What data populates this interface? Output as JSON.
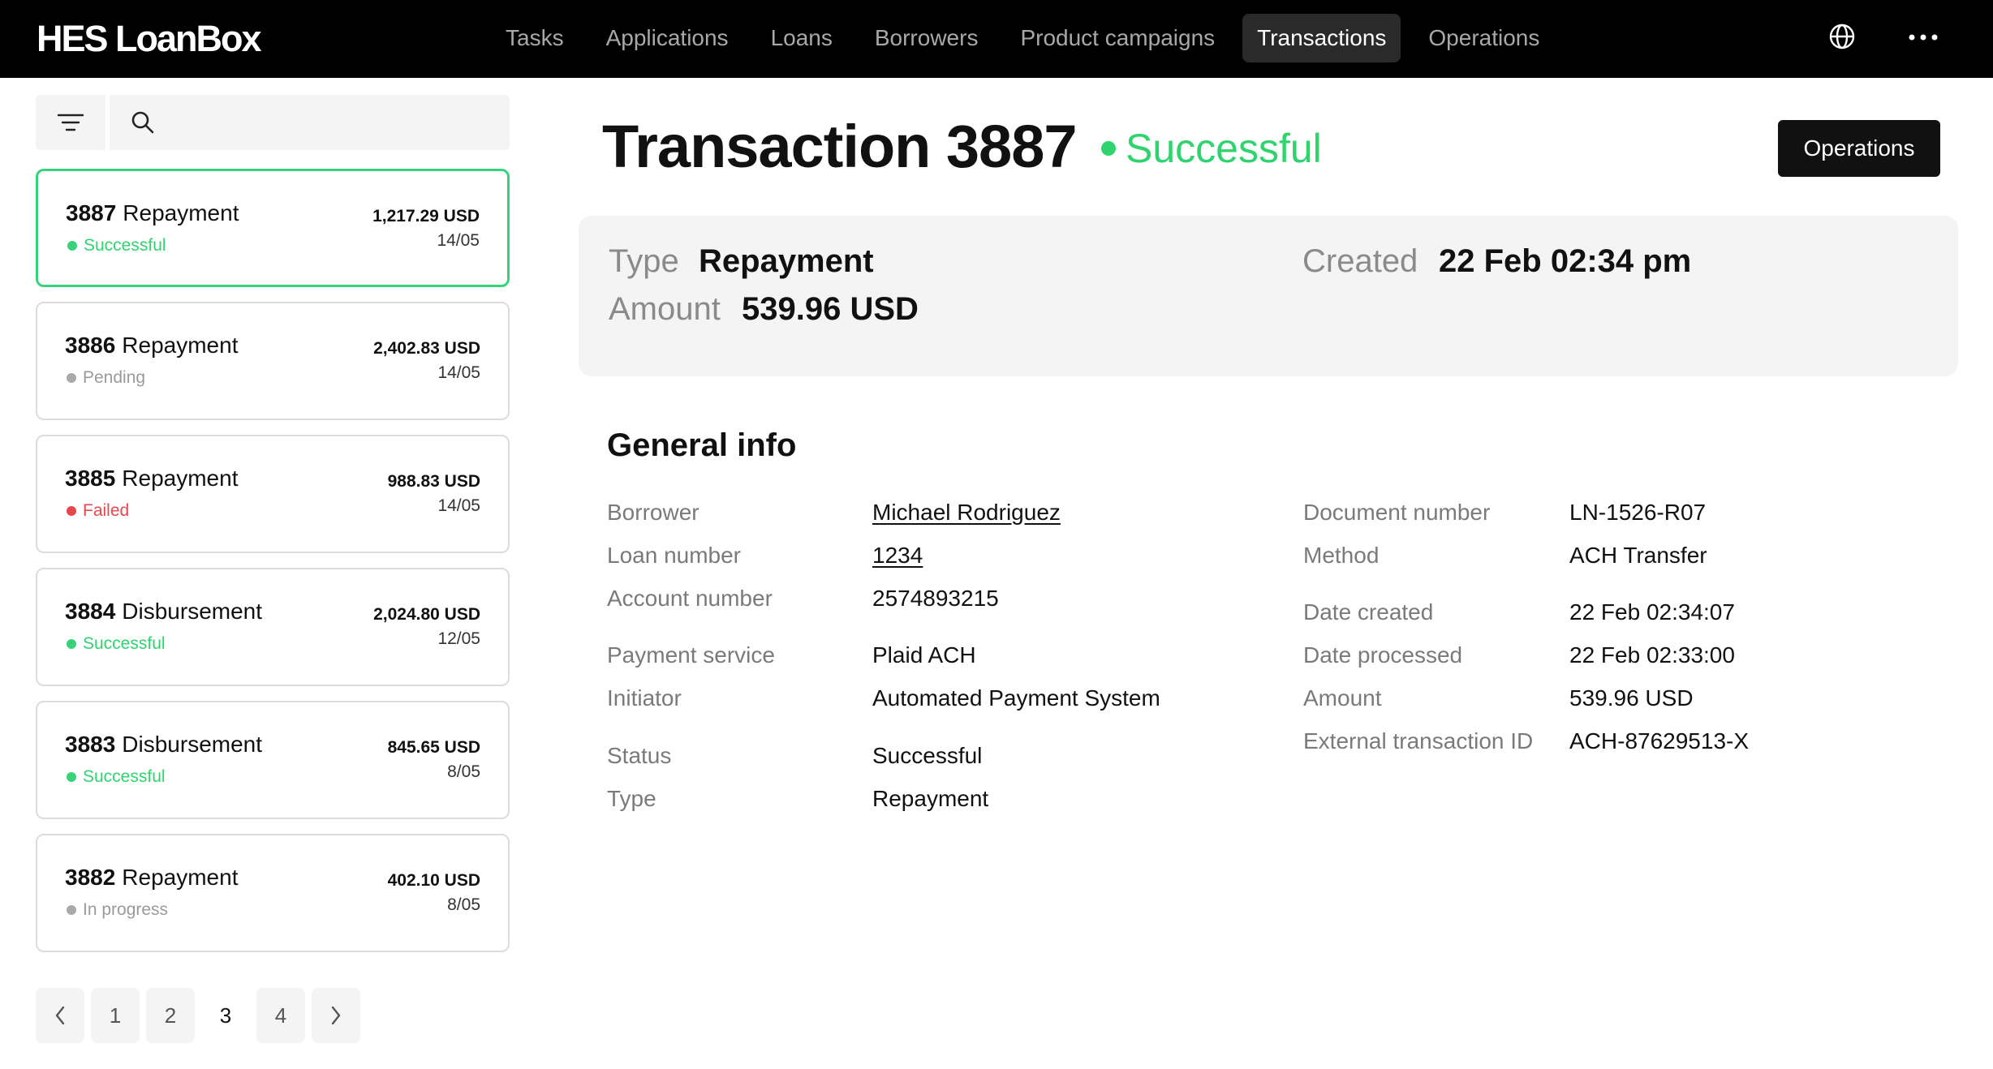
{
  "app": {
    "logo": "HES LoanBox"
  },
  "nav": {
    "items": [
      {
        "label": "Tasks"
      },
      {
        "label": "Applications"
      },
      {
        "label": "Loans"
      },
      {
        "label": "Borrowers"
      },
      {
        "label": "Product campaigns"
      },
      {
        "label": "Transactions"
      },
      {
        "label": "Operations"
      }
    ],
    "active": "Transactions",
    "globe_icon": "globe-icon",
    "more_icon": "more-horizontal-icon"
  },
  "sidebar": {
    "filter_icon": "filter-icon",
    "search_icon": "search-icon",
    "search_value": "",
    "search_placeholder": "",
    "transactions": [
      {
        "number": "3887",
        "type": "Repayment",
        "status": "Successful",
        "status_color": "#36d37a",
        "amount": "1,217.29 USD",
        "date": "14/05",
        "selected": true
      },
      {
        "number": "3886",
        "type": "Repayment",
        "status": "Pending",
        "status_color": "#a9a9a9",
        "amount": "2,402.83 USD",
        "date": "14/05",
        "selected": false
      },
      {
        "number": "3885",
        "type": "Repayment",
        "status": "Failed",
        "status_color": "#e5484d",
        "amount": "988.83 USD",
        "date": "14/05",
        "selected": false
      },
      {
        "number": "3884",
        "type": "Disbursement",
        "status": "Successful",
        "status_color": "#36d37a",
        "amount": "2,024.80 USD",
        "date": "12/05",
        "selected": false
      },
      {
        "number": "3883",
        "type": "Disbursement",
        "status": "Successful",
        "status_color": "#36d37a",
        "amount": "845.65 USD",
        "date": "8/05",
        "selected": false
      },
      {
        "number": "3882",
        "type": "Repayment",
        "status": "In progress",
        "status_color": "#a9a9a9",
        "amount": "402.10 USD",
        "date": "8/05",
        "selected": false
      }
    ],
    "pagination": {
      "prev_icon": "chevron-left-icon",
      "next_icon": "chevron-right-icon",
      "pages": [
        "1",
        "2",
        "3",
        "4"
      ],
      "current": "3"
    }
  },
  "main": {
    "title": "Transaction 3887",
    "status": "Successful",
    "status_color": "#2fd46f",
    "operations_button": "Operations",
    "summary": {
      "type_label": "Type",
      "type_value": "Repayment",
      "amount_label": "Amount",
      "amount_value": "539.96 USD",
      "created_label": "Created",
      "created_value": "22 Feb 02:34 pm"
    },
    "general_info": {
      "title": "General info",
      "left": [
        {
          "label": "Borrower",
          "value": "Michael Rodriguez",
          "link": true
        },
        {
          "label": "Loan number",
          "value": "1234",
          "link": true
        },
        {
          "label": "Account number",
          "value": "2574893215",
          "link": false
        },
        {
          "label": "Payment service",
          "value": "Plaid ACH",
          "link": false
        },
        {
          "label": "Initiator",
          "value": "Automated Payment System",
          "link": false
        },
        {
          "label": "Status",
          "value": "Successful",
          "link": false
        },
        {
          "label": "Type",
          "value": "Repayment",
          "link": false
        }
      ],
      "right": [
        {
          "label": "Document number",
          "value": "LN-1526-R07"
        },
        {
          "label": "Method",
          "value": "ACH Transfer"
        },
        {
          "label": "Date created",
          "value": "22 Feb 02:34:07"
        },
        {
          "label": "Date processed",
          "value": "22 Feb 02:33:00"
        },
        {
          "label": "Amount",
          "value": "539.96 USD"
        },
        {
          "label": "External transaction ID",
          "value": "ACH-87629513-X"
        }
      ]
    }
  }
}
